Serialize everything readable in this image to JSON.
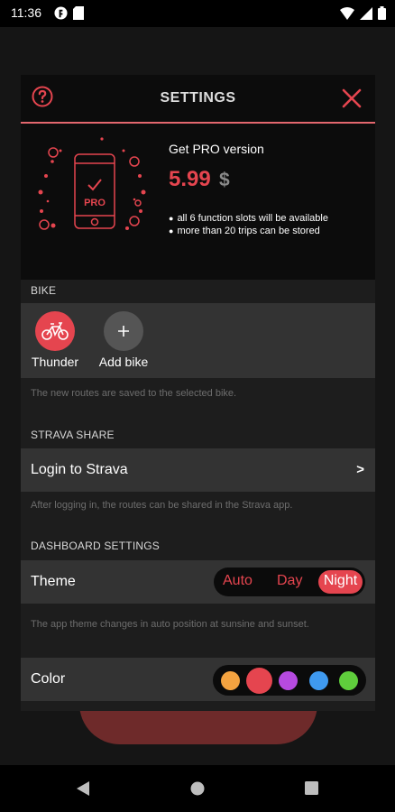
{
  "status_bar": {
    "time": "11:36"
  },
  "dialog": {
    "title": "SETTINGS",
    "pro": {
      "title": "Get PRO version",
      "price": "5.99",
      "currency": "$",
      "illustration_label": "PRO",
      "bullets": [
        "all 6 function slots will be available",
        "more than 20 trips can be stored"
      ]
    },
    "bike": {
      "section": "BIKE",
      "items": [
        {
          "label": "Thunder",
          "icon": "bicycle-icon",
          "color": "#e5454f",
          "selected": true
        },
        {
          "label": "Add bike",
          "icon": "plus-icon",
          "color": "#555555",
          "selected": false
        }
      ],
      "hint": "The new routes are saved to the selected bike."
    },
    "strava": {
      "section": "STRAVA SHARE",
      "login_label": "Login to Strava",
      "chevron": ">",
      "hint": "After logging in, the routes can be shared in the Strava app."
    },
    "dashboard": {
      "section": "DASHBOARD SETTINGS",
      "theme_label": "Theme",
      "theme_options": [
        "Auto",
        "Day",
        "Night"
      ],
      "theme_selected": "Night",
      "hint": "The app theme changes in auto position at sunsine and sunset.",
      "color_label": "Color",
      "colors": [
        "#f4a340",
        "#e5454f",
        "#b64ae0",
        "#3f9af0",
        "#5fce3c"
      ],
      "color_selected": "#e5454f"
    }
  },
  "accent_color": "#e5454f"
}
